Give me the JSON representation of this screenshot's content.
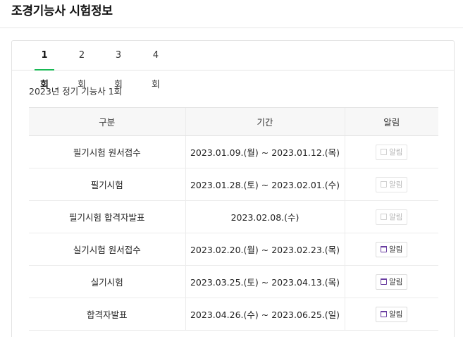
{
  "page": {
    "title": "조경기능사 시험정보"
  },
  "tabs": [
    {
      "label": "1회",
      "active": true
    },
    {
      "label": "2회",
      "active": false
    },
    {
      "label": "3회",
      "active": false
    },
    {
      "label": "4회",
      "active": false
    }
  ],
  "section": {
    "title": "2023년 정기 기능사 1회"
  },
  "table": {
    "headers": {
      "category": "구분",
      "period": "기간",
      "alarm": "알림"
    },
    "rows": [
      {
        "category": "필기시험 원서접수",
        "period": "2023.01.09.(월) ~ 2023.01.12.(목)",
        "alarm_label": "알림",
        "alarm_enabled": false
      },
      {
        "category": "필기시험",
        "period": "2023.01.28.(토) ~ 2023.02.01.(수)",
        "alarm_label": "알림",
        "alarm_enabled": false
      },
      {
        "category": "필기시험 합격자발표",
        "period": "2023.02.08.(수)",
        "alarm_label": "알림",
        "alarm_enabled": false
      },
      {
        "category": "실기시험 원서접수",
        "period": "2023.02.20.(월) ~ 2023.02.23.(목)",
        "alarm_label": "알림",
        "alarm_enabled": true
      },
      {
        "category": "실기시험",
        "period": "2023.03.25.(토) ~ 2023.04.13.(목)",
        "alarm_label": "알림",
        "alarm_enabled": true
      },
      {
        "category": "합격자발표",
        "period": "2023.04.26.(수) ~ 2023.06.25.(일)",
        "alarm_label": "알림",
        "alarm_enabled": true
      }
    ]
  },
  "icons": {
    "alarm": "calendar-icon"
  },
  "colors": {
    "accent": "#19b955",
    "calendar_icon": "#6a3ea1",
    "disabled": "#b5b5b5",
    "header_bg": "#f7f7f7"
  }
}
